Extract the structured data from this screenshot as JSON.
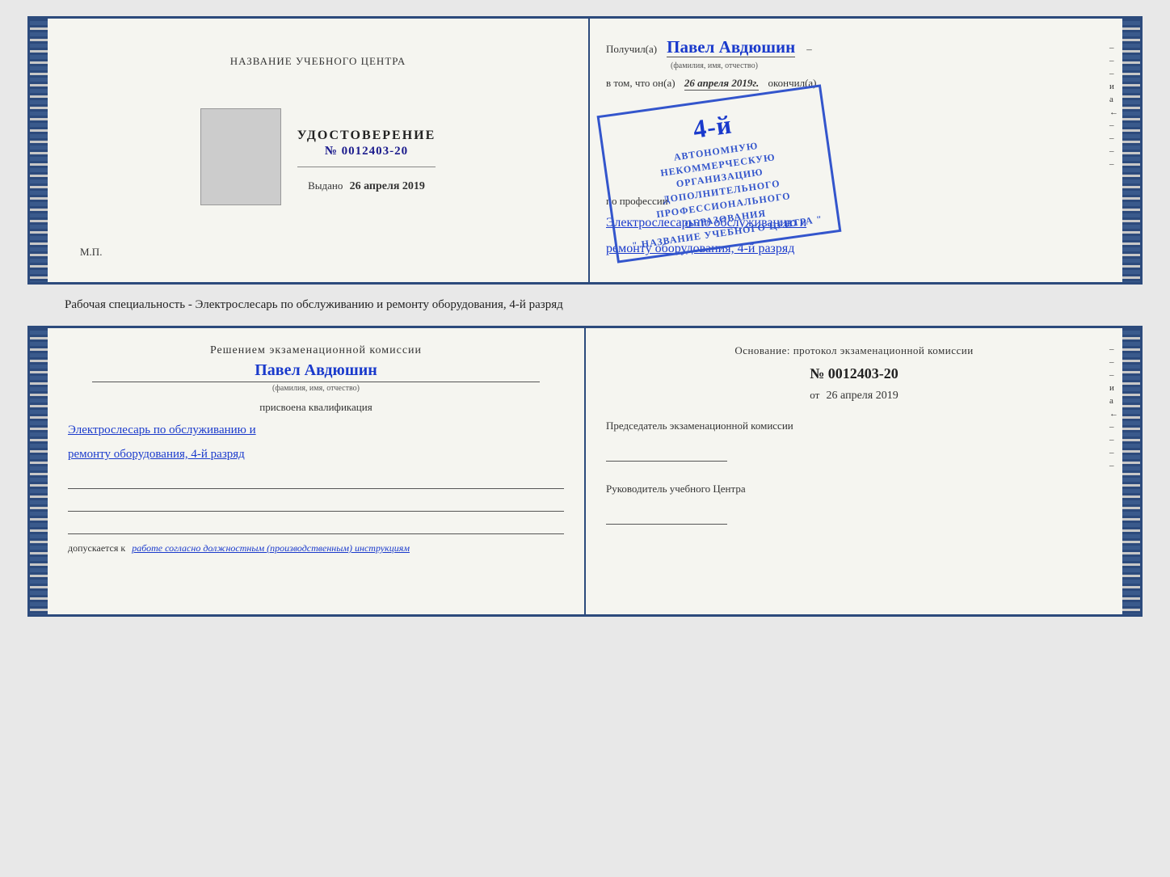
{
  "top_document": {
    "left": {
      "title": "НАЗВАНИЕ УЧЕБНОГО ЦЕНТРА",
      "cert_label": "УДОСТОВЕРЕНИЕ",
      "cert_number": "№ 0012403-20",
      "issued_label": "Выдано",
      "issued_date": "26 апреля 2019",
      "mp_label": "М.П."
    },
    "right": {
      "received_label": "Получил(а)",
      "recipient_name": "Павел Авдюшин",
      "name_subtitle": "(фамилия, имя, отчество)",
      "in_that_label": "в том, что он(а)",
      "date_text": "26 апреля 2019г.",
      "finished_label": "окончил(а)",
      "stamp_line1": "АВТОНОМНУЮ НЕКОММЕРЧЕСКУЮ ОРГАНИЗАЦИЮ",
      "stamp_line2": "ДОПОЛНИТЕЛЬНОГО ПРОФЕССИОНАЛЬНОГО ОБРАЗОВАНИЯ",
      "stamp_line3": "\" НАЗВАНИЕ УЧЕБНОГО ЦЕНТРА \"",
      "stamp_grade": "4-й",
      "by_profession_label": "по профессии",
      "profession_line1": "Электрослесарь по обслуживанию и",
      "profession_line2": "ремонту оборудования, 4-й разряд"
    }
  },
  "middle_text": "Рабочая специальность - Электрослесарь по обслуживанию и ремонту оборудования, 4-й разряд",
  "bottom_document": {
    "left": {
      "commission_text": "Решением экзаменационной комиссии",
      "person_name": "Павел Авдюшин",
      "name_subtitle": "(фамилия, имя, отчество)",
      "qualification_assigned": "присвоена квалификация",
      "qualification_line1": "Электрослесарь по обслуживанию и",
      "qualification_line2": "ремонту оборудования, 4-й разряд",
      "allowed_label": "допускается к",
      "allowed_text": "работе согласно должностным (производственным) инструкциям"
    },
    "right": {
      "basis_label": "Основание: протокол экзаменационной комиссии",
      "protocol_number": "№ 0012403-20",
      "date_from_label": "от",
      "date_from": "26 апреля 2019",
      "chairman_title": "Председатель экзаменационной комиссии",
      "director_title": "Руководитель учебного Центра"
    }
  },
  "side_chars": {
    "char1": "и",
    "char2": "а",
    "char3": "←",
    "dashes": [
      "–",
      "–",
      "–",
      "–",
      "–",
      "–"
    ]
  }
}
